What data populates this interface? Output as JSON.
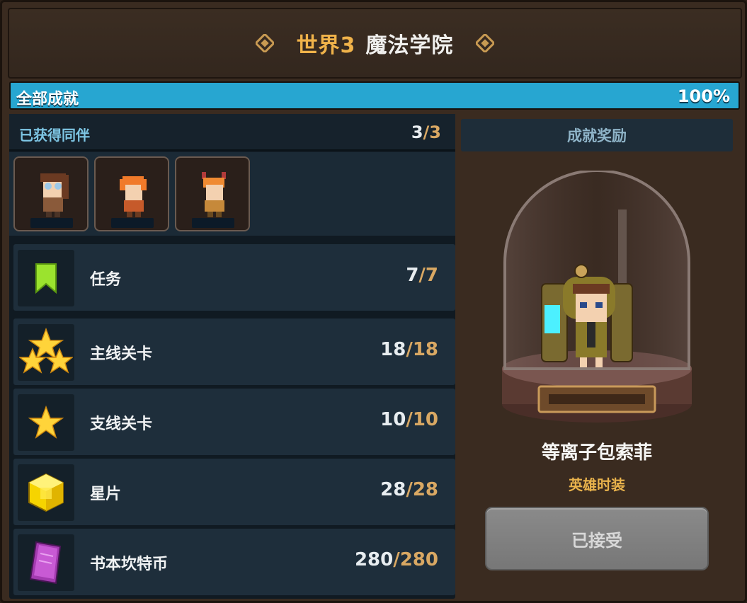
{
  "header": {
    "world": "世界3",
    "title": "魔法学院"
  },
  "progress": {
    "label": "全部成就",
    "percent_text": "100%",
    "value": 1.0
  },
  "companions": {
    "label": "已获得同伴",
    "obtained": "3",
    "total": "3",
    "portraits": [
      {
        "name": "companion-1"
      },
      {
        "name": "companion-2"
      },
      {
        "name": "companion-3"
      }
    ]
  },
  "achievements": [
    {
      "icon": "bookmark-icon",
      "name": "任务",
      "current": "7",
      "total": "7"
    },
    {
      "icon": "three-stars-icon",
      "name": "主线关卡",
      "current": "18",
      "total": "18"
    },
    {
      "icon": "star-icon",
      "name": "支线关卡",
      "current": "10",
      "total": "10"
    },
    {
      "icon": "star-piece-cube-icon",
      "name": "星片",
      "current": "28",
      "total": "28"
    },
    {
      "icon": "book-coin-icon",
      "name": "书本坎特币",
      "current": "280",
      "total": "280"
    }
  ],
  "reward": {
    "header": "成就奖励",
    "name": "等离子包索菲",
    "type": "英雄时装",
    "button": "已接受"
  },
  "colors": {
    "accent_gold": "#f0b34a",
    "progress_blue": "#27a6d1",
    "count_total": "#d9a863"
  }
}
